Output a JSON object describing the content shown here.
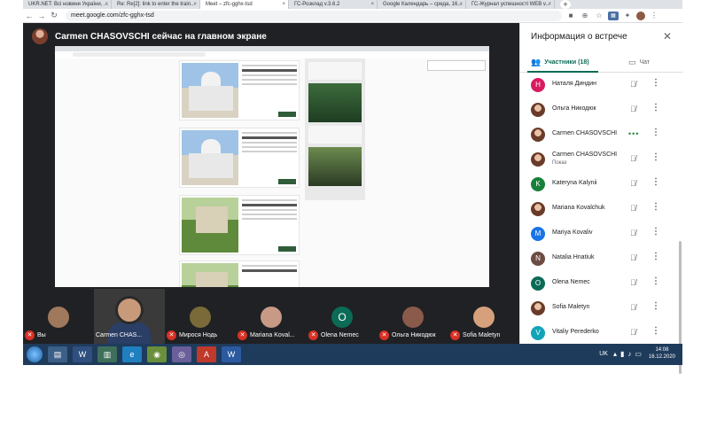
{
  "browser": {
    "tabs": [
      {
        "label": "UKR.NET: Всі новини України, ...",
        "active": false
      },
      {
        "label": "Re: Re[2]: link to enter the train...",
        "active": false
      },
      {
        "label": "Meet – zfc-gghx-tsd",
        "active": true
      },
      {
        "label": "ГС-Розклад v.3.6.2",
        "active": false
      },
      {
        "label": "Google Календарь – среда, 16...",
        "active": false
      },
      {
        "label": "ГС-Журнал успешності WEB v...",
        "active": false
      }
    ],
    "url": "meet.google.com/zfc-gghx-tsd"
  },
  "meet": {
    "presenter_title": "Carmen CHASOVSCHI сейчас на главном экране",
    "thumbnails": [
      {
        "name": "Вы",
        "type": "photo",
        "color": "#a0785c"
      },
      {
        "name": "Carmen CHAS...",
        "type": "video"
      },
      {
        "name": "Мироcя Нодь",
        "type": "photo",
        "color": "#7a6a3a"
      },
      {
        "name": "Mariana Koval...",
        "type": "photo",
        "color": "#c79a86"
      },
      {
        "name": "Olena Nemec",
        "type": "letter",
        "letter": "O"
      },
      {
        "name": "Ольга Никодюк",
        "type": "photo",
        "color": "#8a5a4a"
      },
      {
        "name": "Sofia Maletyn",
        "type": "photo",
        "color": "#d6a07c"
      }
    ]
  },
  "panel": {
    "title": "Информация о встрече",
    "tab_people": "Участники (18)",
    "tab_chat": "Чат",
    "participants": [
      {
        "name": "Наталя Диндин",
        "avatar": "letter",
        "letter": "Н",
        "color": "#d81b60",
        "status": "muted"
      },
      {
        "name": "Ольга Никодюк",
        "avatar": "photo",
        "status": "muted"
      },
      {
        "name": "Carmen CHASOVSCHI",
        "avatar": "photo",
        "status": "speaking"
      },
      {
        "name": "Carmen CHASOVSCHI",
        "sub": "Показ",
        "avatar": "photo",
        "status": "presenting"
      },
      {
        "name": "Kateryna Kalynii",
        "avatar": "letter",
        "letter": "K",
        "color": "#188038",
        "status": "muted"
      },
      {
        "name": "Mariana Kovalchuk",
        "avatar": "photo",
        "status": "muted"
      },
      {
        "name": "Mariya Kovaliv",
        "avatar": "letter",
        "letter": "M",
        "color": "#1a73e8",
        "status": "muted"
      },
      {
        "name": "Natalia Hnatiuk",
        "avatar": "letter",
        "letter": "N",
        "color": "#6d4c41",
        "status": "muted"
      },
      {
        "name": "Olena Nemec",
        "avatar": "letter",
        "letter": "O",
        "color": "#0b6b57",
        "status": "muted"
      },
      {
        "name": "Sofia Maletyn",
        "avatar": "photo",
        "status": "muted"
      },
      {
        "name": "Vitaliy Perederko",
        "avatar": "letter",
        "letter": "V",
        "color": "#12a4b8",
        "status": "muted"
      }
    ]
  },
  "taskbar": {
    "lang": "UK",
    "time": "14:08",
    "date": "16.12.2020"
  }
}
